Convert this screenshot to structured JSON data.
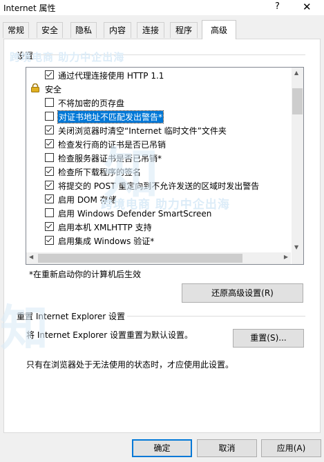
{
  "window": {
    "title": "Internet 属性",
    "help_glyph": "?",
    "close_glyph": "✕"
  },
  "tabs": [
    {
      "label": "常规"
    },
    {
      "label": "安全"
    },
    {
      "label": "隐私"
    },
    {
      "label": "内容"
    },
    {
      "label": "连接"
    },
    {
      "label": "程序"
    },
    {
      "label": "高级"
    }
  ],
  "active_tab": "高级",
  "settings": {
    "label": "设置",
    "rows": [
      {
        "type": "check",
        "checked": true,
        "label": "通过代理连接使用 HTTP 1.1"
      },
      {
        "type": "category",
        "label": "安全",
        "icon": "lock-icon"
      },
      {
        "type": "check",
        "checked": false,
        "label": "不将加密的页存盘"
      },
      {
        "type": "check",
        "checked": false,
        "label": "对证书地址不匹配发出警告*",
        "selected": true
      },
      {
        "type": "check",
        "checked": true,
        "label": "关闭浏览器时清空“Internet 临时文件”文件夹"
      },
      {
        "type": "check",
        "checked": true,
        "label": "检查发行商的证书是否已吊销"
      },
      {
        "type": "check",
        "checked": false,
        "label": "检查服务器证书是否已吊销*"
      },
      {
        "type": "check",
        "checked": true,
        "label": "检查所下载程序的签名"
      },
      {
        "type": "check",
        "checked": true,
        "label": "将提交的 POST 重定向到不允许发送的区域时发出警告"
      },
      {
        "type": "check",
        "checked": true,
        "label": "启用 DOM 存储"
      },
      {
        "type": "check",
        "checked": false,
        "label": "启用 Windows Defender SmartScreen"
      },
      {
        "type": "check",
        "checked": true,
        "label": "启用本机 XMLHTTP 支持"
      },
      {
        "type": "check",
        "checked": true,
        "label": "启用集成 Windows 验证*"
      }
    ],
    "restart_note": "*在重新启动你的计算机后生效",
    "restore_button": "还原高级设置(R)"
  },
  "reset": {
    "heading": "重置 Internet Explorer 设置",
    "description": "将 Internet Explorer 设置重置为默认设置。",
    "button": "重置(S)...",
    "hint": "只有在浏览器处于无法使用的状态时，才应使用此设置。"
  },
  "footer": {
    "ok": "确定",
    "cancel": "取消",
    "apply": "应用(A)"
  },
  "watermark": {
    "text1": "跨境电商 助力中企出海",
    "text2": "跨境电商 助力中企出海",
    "brand": "知",
    "brand2": "知"
  }
}
